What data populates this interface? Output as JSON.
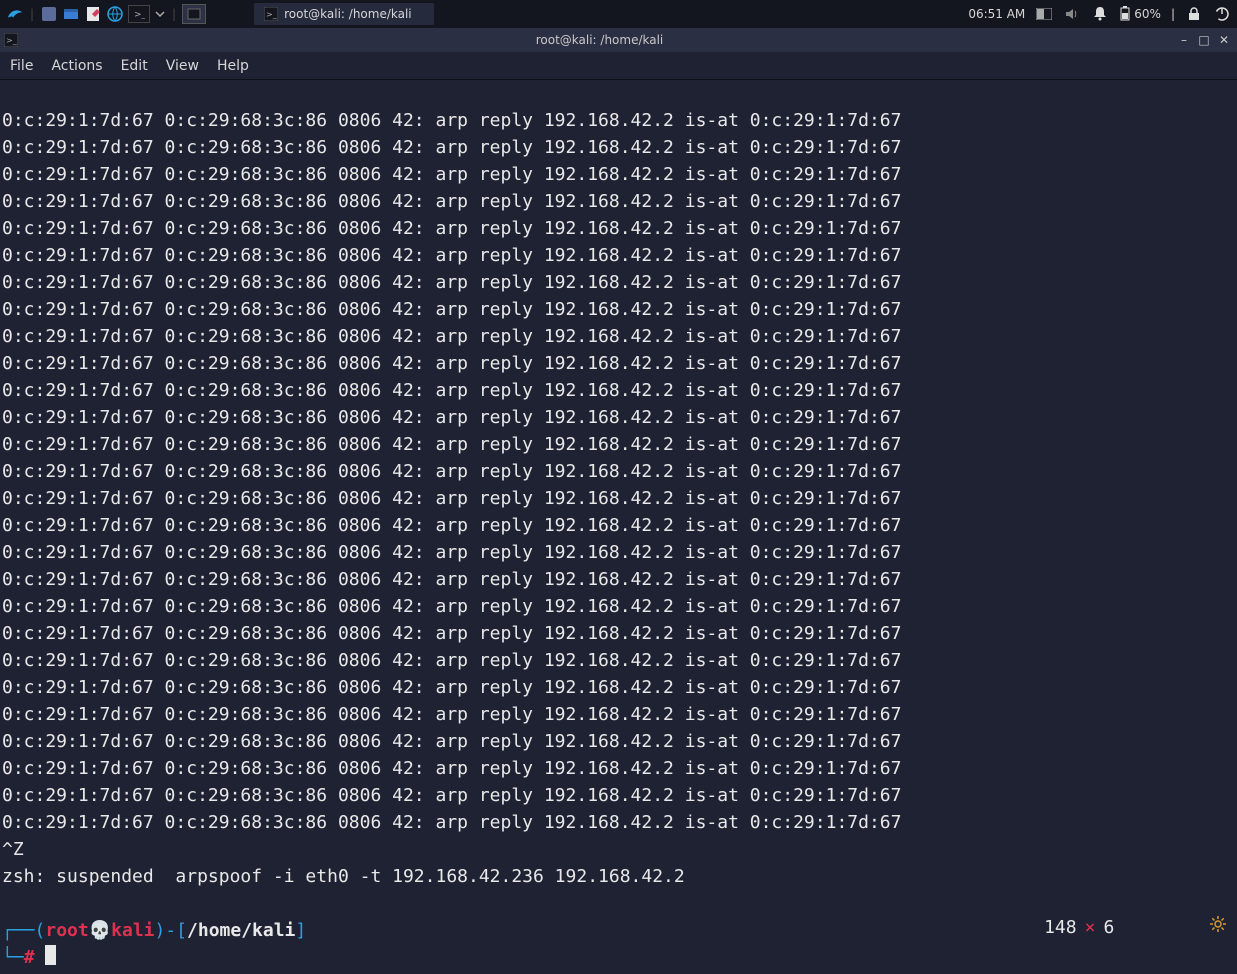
{
  "panel": {
    "taskbar_label": "root@kali: /home/kali",
    "clock": "06:51 AM",
    "battery": "60%",
    "icons": {
      "kali": "kali-logo",
      "workspace": "workspace",
      "files": "files",
      "note": "note",
      "web": "web",
      "term1": "terminal",
      "term2": "terminal-active",
      "dropdown": "chevron-down",
      "workspace2": "workspace-indicator",
      "volume": "volume",
      "bell": "bell",
      "battery_icon": "battery",
      "lock": "lock",
      "power": "power"
    }
  },
  "window": {
    "title": "root@kali: /home/kali",
    "menu": [
      "File",
      "Actions",
      "Edit",
      "View",
      "Help"
    ]
  },
  "terminal": {
    "arp_line": "0:c:29:1:7d:67 0:c:29:68:3c:86 0806 42: arp reply 192.168.42.2 is-at 0:c:29:1:7d:67",
    "arp_count": 27,
    "ctrl_z": "^Z",
    "suspended": "zsh: suspended  arpspoof -i eth0 -t 192.168.42.236 192.168.42.2",
    "prompt": {
      "open1": "┌──(",
      "user": "root",
      "skull": "💀",
      "host": "kali",
      "mid": ")-[",
      "path": "/home/kali",
      "close": "]",
      "open2": "└─",
      "hash": "#"
    }
  },
  "status": {
    "a": "148",
    "x": "×",
    "b": "6"
  }
}
